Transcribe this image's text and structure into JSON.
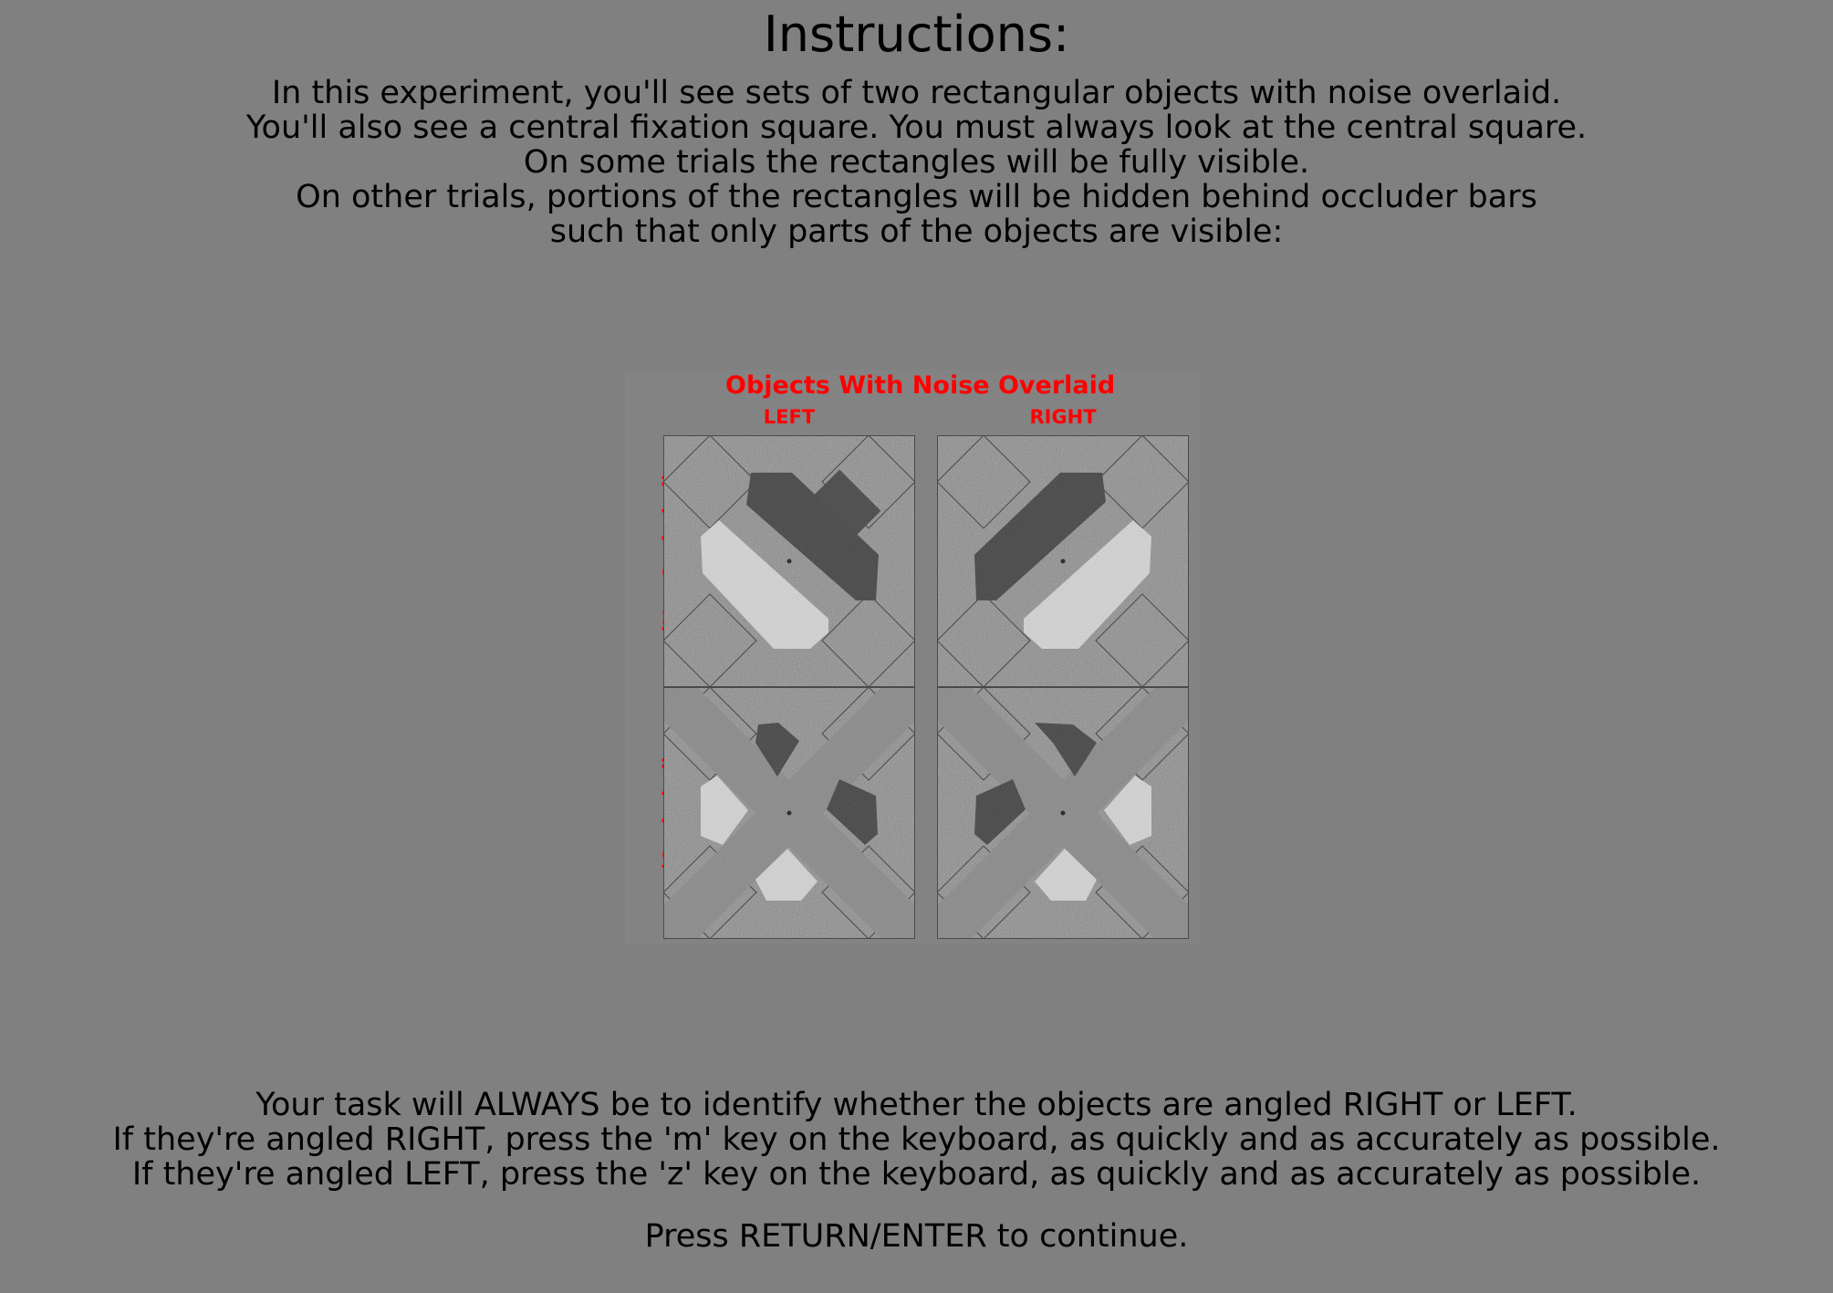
{
  "header": {
    "title": "Instructions:"
  },
  "intro_lines": [
    "In this experiment, you'll see sets of two rectangular objects with noise overlaid.",
    "You'll also see a central fixation square. You must always look at the central square.",
    "On some trials the rectangles will be fully visible.",
    "On other trials, portions of the rectangles will be hidden behind occluder bars",
    "such that only parts of the objects are visible:"
  ],
  "figure": {
    "title": "Objects With Noise Overlaid",
    "col_left": "LEFT",
    "col_right": "RIGHT",
    "row_top": "(Not Occluded)",
    "row_bottom": "(Occluded)",
    "colors": {
      "label": "#ff0000",
      "dark_object": "#3c3c3c",
      "light_object": "#d2d2d2",
      "background": "#808080"
    }
  },
  "task_lines": [
    "Your task will ALWAYS be to identify whether the objects are angled RIGHT or LEFT.",
    "If they're angled RIGHT, press the 'm' key on the keyboard, as quickly and as accurately as possible.",
    "If they're angled LEFT, press the 'z' key on the keyboard, as quickly and as accurately as possible."
  ],
  "footer": {
    "continue": "Press RETURN/ENTER to continue."
  }
}
